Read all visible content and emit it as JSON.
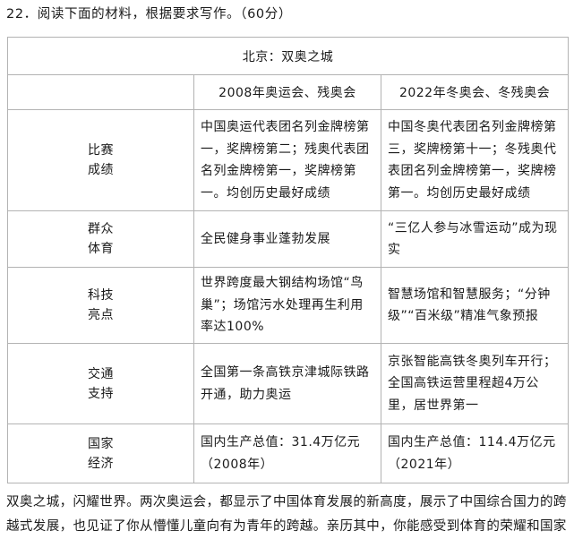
{
  "question": {
    "title": "22．阅读下面的材料，根据要求写作。（60分）"
  },
  "table": {
    "caption": "北京：双奥之城",
    "columns": [
      "2008年奥运会、残奥会",
      "2022年冬奥会、冬残奥会"
    ],
    "rows": [
      {
        "label_lines": [
          "比赛",
          "成绩"
        ],
        "col_2008": "中国奥运代表团名列金牌榜第一，奖牌榜第二；残奥代表团名列金牌榜第一，奖牌榜第一。均创历史最好成绩",
        "col_2022": "中国冬奥代表团名列金牌榜第三，奖牌榜第十一；冬残奥代表团名列金牌榜第一，奖牌榜第一。均创历史最好成绩"
      },
      {
        "label_lines": [
          "群众",
          "体育"
        ],
        "col_2008": "全民健身事业蓬勃发展",
        "col_2022": "“三亿人参与冰雪运动”成为现实"
      },
      {
        "label_lines": [
          "科技",
          "亮点"
        ],
        "col_2008": "世界跨度最大钢结构场馆“鸟巢”；场馆污水处理再生利用率达100%",
        "col_2022": "智慧场馆和智慧服务；“分钟级”“百米级”精准气象预报"
      },
      {
        "label_lines": [
          "交通",
          "支持"
        ],
        "col_2008": "全国第一条高铁京津城际铁路开通，助力奥运",
        "col_2022": "京张智能高铁冬奥列车开行；全国高铁运营里程超4万公里，居世界第一"
      },
      {
        "label_lines": [
          "国家",
          "经济"
        ],
        "col_2008": "国内生产总值：31.4万亿元（2008年）",
        "col_2022": "国内生产总值：114.4万亿元（2021年）"
      }
    ]
  },
  "passage": {
    "text": "双奥之城，闪耀世界。两次奥运会，都显示了中国体育发展的新高度，展示了中国综合国力的跨越式发展，也见证了你从懵懂儿童向有为青年的跨越。亲历其中，你能感受到体育的荣耀和国家"
  }
}
